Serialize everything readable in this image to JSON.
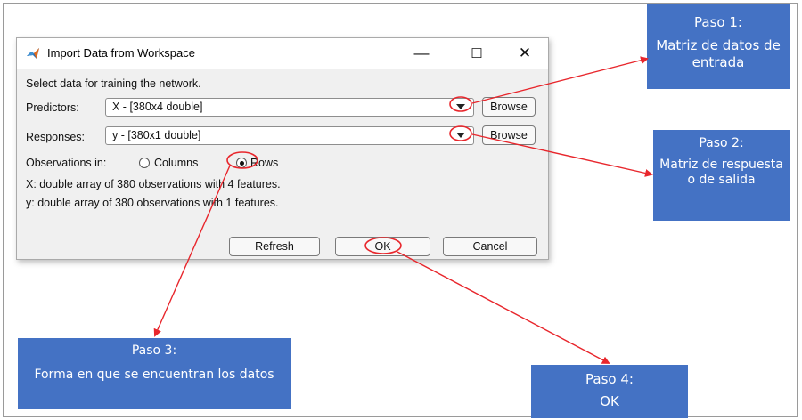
{
  "dialog": {
    "title": "Import Data from Workspace",
    "minimize": "—",
    "maximize": "☐",
    "close": "✕",
    "instruction": "Select data for training the network.",
    "predictors_label": "Predictors:",
    "predictors_value": "X - [380x4 double]",
    "responses_label": "Responses:",
    "responses_value": "y - [380x1 double]",
    "browse_label": "Browse",
    "observations_label": "Observations in:",
    "option_columns": "Columns",
    "option_rows": "Rows",
    "selected_option": "Rows",
    "x_info": "X: double array of 380 observations with 4 features.",
    "y_info": "y: double array of 380 observations with 1 features.",
    "refresh_label": "Refresh",
    "ok_label": "OK",
    "cancel_label": "Cancel"
  },
  "callouts": {
    "paso1": {
      "heading": "Paso 1:",
      "body": "Matriz de datos de entrada"
    },
    "paso2": {
      "heading": "Paso 2:",
      "body": "Matriz de respuesta o de salida"
    },
    "paso3": {
      "heading": "Paso 3:",
      "body": "Forma en que se encuentran los datos"
    },
    "paso4": {
      "heading": "Paso 4:",
      "body": "OK"
    }
  },
  "colors": {
    "callout_fill": "#4472c4",
    "annotation_red": "#e8262c",
    "dialog_bg": "#f0f0f0"
  },
  "icons": {
    "app": "matlab-logo-icon",
    "dropdown": "chevron-down-icon"
  }
}
